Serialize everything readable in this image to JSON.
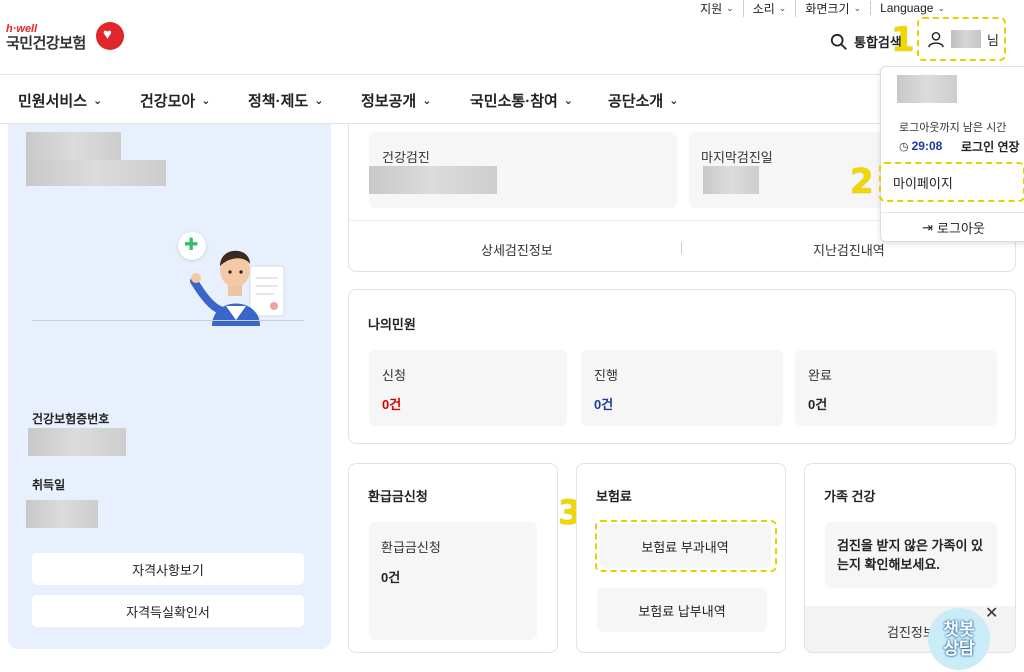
{
  "utility": {
    "items": [
      {
        "label": "지원"
      },
      {
        "label": "소리"
      },
      {
        "label": "화면크기"
      },
      {
        "label": "Language"
      }
    ]
  },
  "header": {
    "logo_small": "h·well",
    "logo_name": "국민건강보험",
    "search_label": "통합검색",
    "user_suffix": "님"
  },
  "steps": [
    "1",
    "2",
    "3"
  ],
  "nav": {
    "items": [
      {
        "label": "민원서비스"
      },
      {
        "label": "건강모아"
      },
      {
        "label": "정책·제도"
      },
      {
        "label": "정보공개"
      },
      {
        "label": "국민소통·참여"
      },
      {
        "label": "공단소개"
      }
    ]
  },
  "left_panel": {
    "insurance_number_label": "건강보험증번호",
    "acquire_date_label": "취득일",
    "btn_qualification": "자격사항보기",
    "btn_certificate": "자격득실확인서"
  },
  "checkup": {
    "checkup_label": "건강검진",
    "last_checkup_label": "마지막검진일",
    "detail_link": "상세검진정보",
    "history_link": "지난검진내역"
  },
  "complaints": {
    "title": "나의민원",
    "items": [
      {
        "label": "신청",
        "value": "0건",
        "color": "#d40000"
      },
      {
        "label": "진행",
        "value": "0건",
        "color": "#1b3a9a"
      },
      {
        "label": "완료",
        "value": "0건",
        "color": "#222222"
      }
    ]
  },
  "refund": {
    "title": "환급금신청",
    "sub_label": "환급금신청",
    "value": "0건"
  },
  "premium": {
    "title": "보험료",
    "btn_charge": "보험료 부과내역",
    "btn_payment": "보험료 납부내역"
  },
  "family": {
    "title": "가족 건강",
    "message": "검진을 받지 않은 가족이 있는지 확인해보세요.",
    "link": "검진정보"
  },
  "dropdown": {
    "remaining_label": "로그아웃까지 남은 시간",
    "timer": "29:08",
    "extend": "로그인 연장",
    "mypage": "마이페이지",
    "logout": "로그아웃"
  },
  "chatbot": {
    "line1": "챗봇",
    "line2": "상담"
  },
  "colors": {
    "accent_yellow": "#f0d700",
    "brand_red": "#e0262b",
    "panel_blue": "#e8f0fd"
  }
}
